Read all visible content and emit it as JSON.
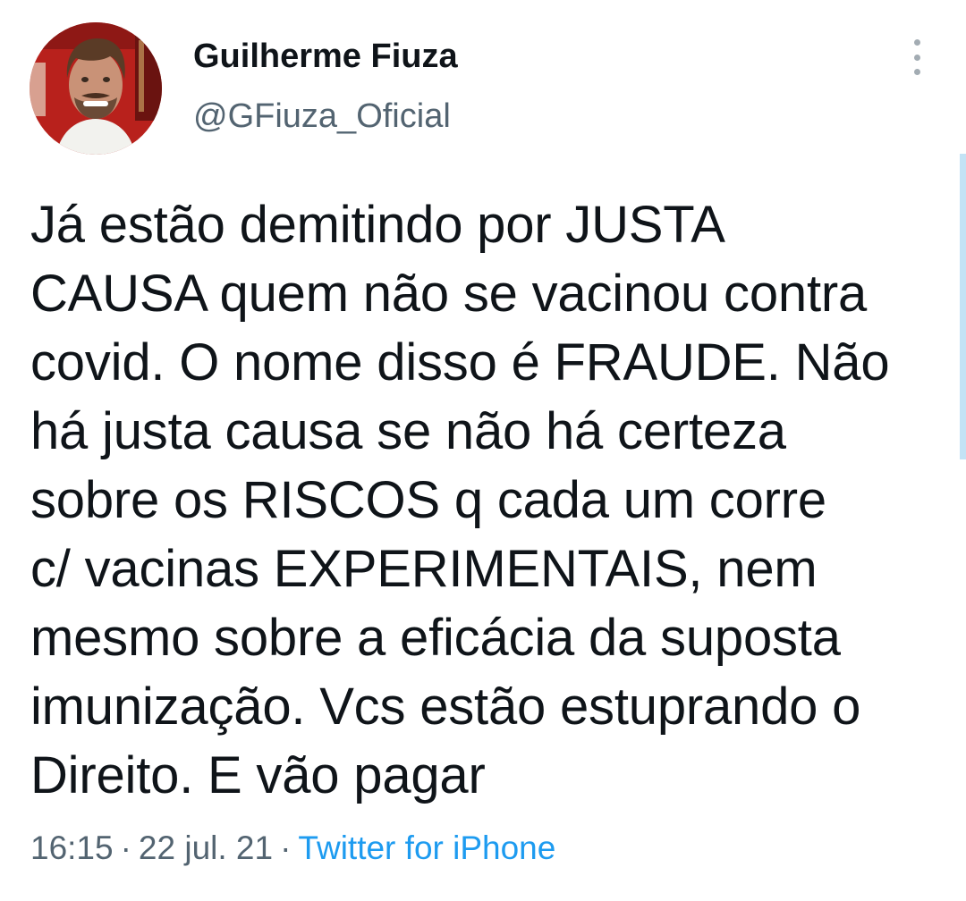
{
  "author": {
    "display_name": "Guilherme Fiuza",
    "handle": "@GFiuza_Oficial",
    "avatar_icon": "profile-photo"
  },
  "menu": {
    "icon": "more-vertical-icon"
  },
  "tweet": {
    "lines": [
      "Já estão demitindo por JUSTA",
      "CAUSA quem não se vacinou contra",
      "covid. O nome disso é FRAUDE. Não",
      "há justa causa se não há certeza",
      "sobre os RISCOS q cada um corre",
      "c/ vacinas EXPERIMENTAIS, nem",
      "mesmo sobre a eficácia da suposta",
      "imunização. Vcs estão estuprando o",
      "Direito. E vão pagar"
    ]
  },
  "meta": {
    "time": "16:15",
    "separator": "·",
    "date": "22 jul. 21",
    "source": "Twitter for iPhone"
  },
  "colors": {
    "text": "#0f1419",
    "secondary": "#536471",
    "link": "#1d9bf0"
  }
}
